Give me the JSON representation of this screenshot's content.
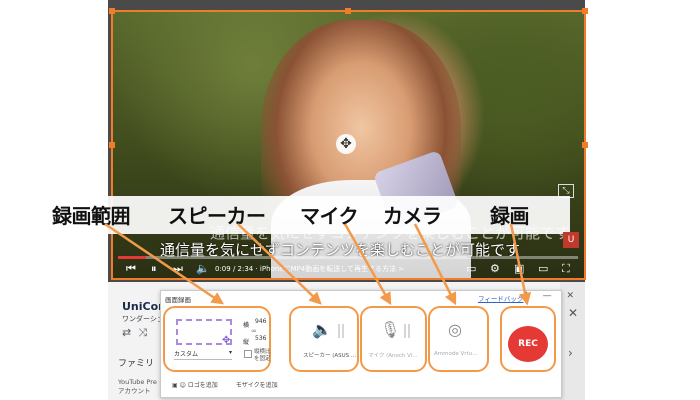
{
  "callouts": {
    "area": "録画範囲",
    "speaker": "スピーカー",
    "mic": "マイク",
    "camera": "カメラ",
    "record": "録画"
  },
  "video": {
    "subtitle": "通信量を気にせずコンテンツを楽しむことが可能です",
    "subtitle_ghost": "通信量を気にせずコンテンツを楽しむことが可能です",
    "time": "0:09 / 2:34 · iPhoneにMP4動画を転送して再生する方法 >",
    "progress": 0.06,
    "brand_mark": "U"
  },
  "background_panel": {
    "title": "UniConv",
    "subtitle": "ワンダーシェ",
    "family_label": "ファミリ",
    "yt_premium": "YouTube Pre\nアカウント"
  },
  "dialog": {
    "title": "画面録画",
    "feedback_link": "フィードバック",
    "window_controls": "? — ✕",
    "region": {
      "preset": "カスタム",
      "width_label": "横",
      "width_value": "946",
      "height_label": "縦",
      "height_value": "536",
      "aspect_label": "縦横比を固定"
    },
    "speaker_device": "スピーカー (ASUS ...",
    "mic_device": "マイク (Anoch Vi...",
    "camera_device": "Ammode Vrtu...",
    "rec_label": "REC",
    "tools": "ロゴを追加　　　モザイクを追加"
  },
  "icons": {
    "move": "move-cross-icon",
    "speaker": "speaker-icon",
    "mic": "mic-off-icon",
    "camera": "camera-off-icon"
  },
  "colors": {
    "accent_orange": "#f39a4a",
    "rec_red": "#e53935",
    "frame_orange": "#f07c2a"
  }
}
